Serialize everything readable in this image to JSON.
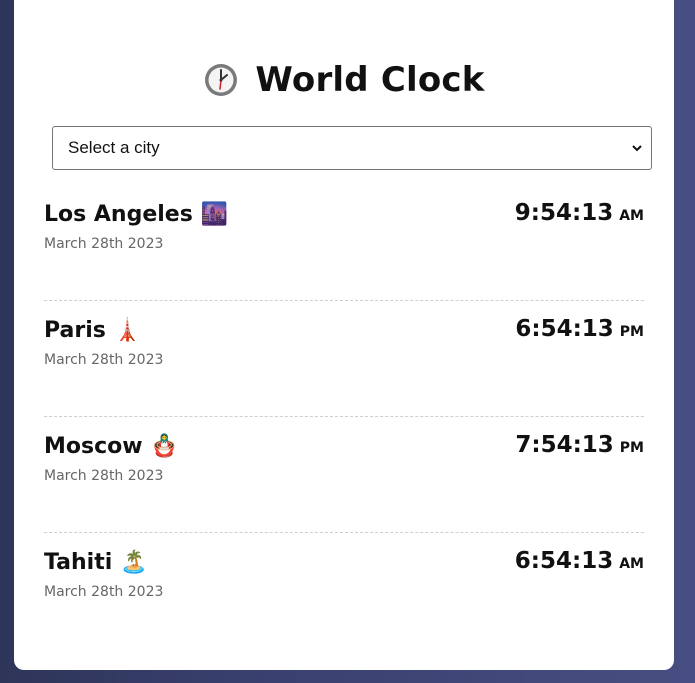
{
  "app": {
    "title": "World Clock",
    "title_icon": "clock-icon"
  },
  "city_select": {
    "selected": "Select a city"
  },
  "cities": [
    {
      "name": "Los Angeles",
      "emoji": "🌆",
      "emoji_name": "cityscape-icon",
      "date": "March 28th 2023",
      "time": "9:54:13",
      "ampm": "AM"
    },
    {
      "name": "Paris",
      "emoji": "🗼",
      "emoji_name": "tower-icon",
      "date": "March 28th 2023",
      "time": "6:54:13",
      "ampm": "PM"
    },
    {
      "name": "Moscow",
      "emoji": "🪆",
      "emoji_name": "nesting-doll-icon",
      "date": "March 28th 2023",
      "time": "7:54:13",
      "ampm": "PM"
    },
    {
      "name": "Tahiti",
      "emoji": "🏝️",
      "emoji_name": "island-icon",
      "date": "March 28th 2023",
      "time": "6:54:13",
      "ampm": "AM"
    }
  ],
  "colors": {
    "background": "#3a4170",
    "card": "#ffffff",
    "divider": "#cfcfcf",
    "date_text": "#666666"
  }
}
